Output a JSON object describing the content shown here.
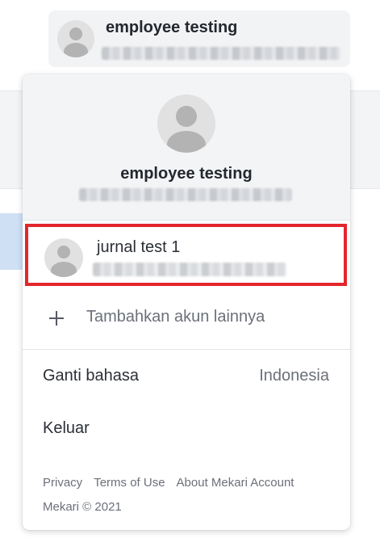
{
  "header": {
    "user_name": "employee testing"
  },
  "dropdown": {
    "current_user": {
      "name": "employee testing"
    },
    "accounts": [
      {
        "name": "jurnal test 1"
      }
    ],
    "add_account_label": "Tambahkan akun lainnya",
    "language": {
      "label": "Ganti bahasa",
      "value": "Indonesia"
    },
    "logout_label": "Keluar",
    "footer": {
      "links": [
        "Privacy",
        "Terms of Use",
        "About Mekari Account"
      ],
      "copyright": "Mekari © 2021"
    }
  },
  "icons": {
    "avatar": "user-avatar-icon",
    "add": "plus-icon"
  },
  "colors": {
    "highlight_border": "#e3262c",
    "panel_header_bg": "#f3f4f6",
    "muted_text": "#6b7079"
  }
}
